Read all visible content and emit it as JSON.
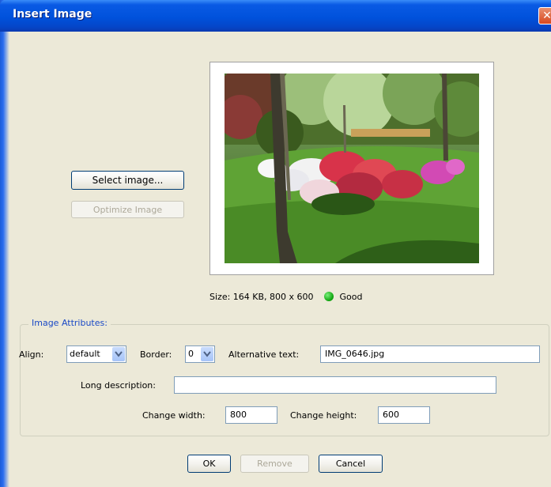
{
  "window": {
    "title": "Insert Image",
    "close_glyph": "✕"
  },
  "buttons": {
    "select_image": "Select image...",
    "optimize_image": "Optimize Image",
    "ok": "OK",
    "remove": "Remove",
    "cancel": "Cancel"
  },
  "preview": {
    "size_text": "Size: 164 KB,  800 x 600",
    "status_text": "Good",
    "status_color": "#0aa00a"
  },
  "attributes": {
    "legend": "Image Attributes:",
    "align_label": "Align:",
    "align_value": "default",
    "border_label": "Border:",
    "border_value": "0",
    "alt_label": "Alternative text:",
    "alt_value": "IMG_0646.jpg",
    "long_desc_label": "Long description:",
    "long_desc_value": "",
    "width_label": "Change width:",
    "width_value": "800",
    "height_label": "Change height:",
    "height_value": "600"
  },
  "icons": {
    "close": "close-icon",
    "dropdown": "chevron-down-icon",
    "status": "status-dot-icon"
  }
}
